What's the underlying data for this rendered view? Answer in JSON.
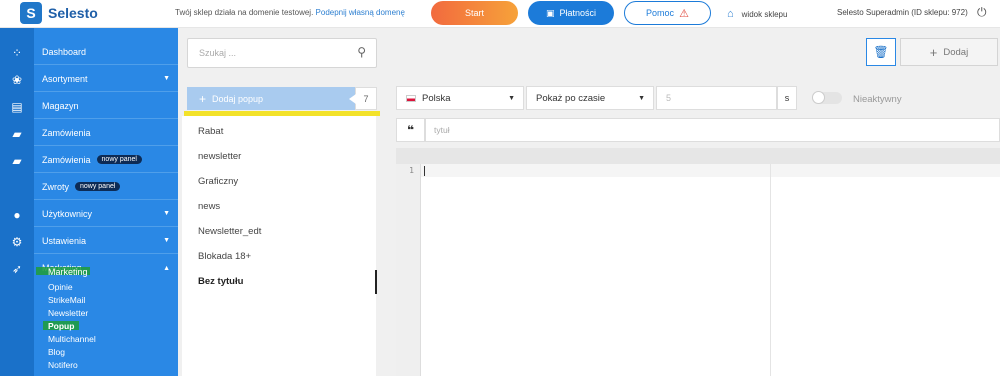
{
  "header": {
    "logo_text": "Selesto",
    "notice_text": "Twój sklep działa na domenie testowej.",
    "notice_link": "Podepnij własną domenę",
    "start_label": "Start",
    "payments_label": "Płatności",
    "help_label": "Pomoc",
    "shop_view_label": "widok sklepu",
    "admin_label": "Selesto Superadmin (ID sklepu: 972)"
  },
  "sidebar": {
    "items": [
      {
        "label": "Dashboard",
        "arrow": ""
      },
      {
        "label": "Asortyment",
        "arrow": "▼"
      },
      {
        "label": "Magazyn",
        "arrow": ""
      },
      {
        "label": "Zamówienia",
        "arrow": ""
      },
      {
        "label": "Zamówienia",
        "badge": "nowy panel",
        "arrow": ""
      },
      {
        "label": "Zwroty",
        "badge": "nowy panel",
        "arrow": ""
      },
      {
        "label": "Użytkownicy",
        "arrow": "▼"
      },
      {
        "label": "Ustawienia",
        "arrow": "▼"
      },
      {
        "label": "Marketing",
        "arrow": "▲"
      }
    ],
    "marketing_sub": [
      "Opinie",
      "StrikeMail",
      "Newsletter",
      "Popup",
      "Multichannel",
      "Blog",
      "Notifero"
    ]
  },
  "list_panel": {
    "search_placeholder": "Szukaj ...",
    "add_label": "Dodaj popup",
    "count": "7",
    "items": [
      "Rabat",
      "newsletter",
      "Graficzny",
      "news",
      "Newsletter_edt",
      "Blokada 18+",
      "Bez tytułu"
    ]
  },
  "editor": {
    "add_label": "Dodaj",
    "language": "Polska",
    "show_mode": "Pokaż po czasie",
    "seconds_placeholder": "5",
    "seconds_unit": "s",
    "status_label": "Nieaktywny",
    "title_placeholder": "tytuł",
    "line_number": "1"
  },
  "colors": {
    "primary": "#2a88e5",
    "iconbar": "#1a71c9",
    "start_from": "#f26a3e",
    "start_to": "#f6a23a",
    "highlight_green": "#1e9d3a",
    "highlight_yellow": "#f3e22a"
  }
}
